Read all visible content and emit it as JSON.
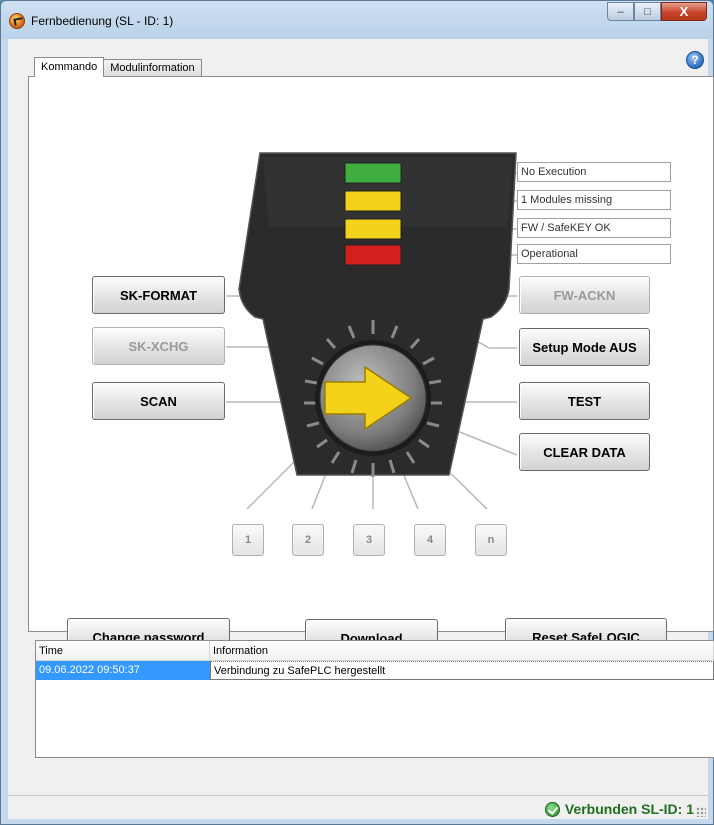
{
  "window": {
    "title": "Fernbedienung (SL - ID: 1)",
    "controls": {
      "minimize": "–",
      "maximize": "□",
      "close": "X"
    }
  },
  "tabs": [
    {
      "label": "Kommando",
      "active": true
    },
    {
      "label": "Modulinformation",
      "active": false
    }
  ],
  "help": {
    "label": "?"
  },
  "status_indicators": [
    {
      "label": "No Execution",
      "led_color": "#3fae3f"
    },
    {
      "label": "1 Modules missing",
      "led_color": "#f2d21a"
    },
    {
      "label": "FW / SafeKEY OK",
      "led_color": "#f2d21a"
    },
    {
      "label": "Operational",
      "led_color": "#d41f1f"
    }
  ],
  "left_buttons": [
    {
      "label": "SK-FORMAT",
      "enabled": true
    },
    {
      "label": "SK-XCHG",
      "enabled": false
    },
    {
      "label": "SCAN",
      "enabled": true
    }
  ],
  "right_buttons": [
    {
      "label": "FW-ACKN",
      "enabled": false
    },
    {
      "label": "Setup Mode AUS",
      "enabled": true
    },
    {
      "label": "TEST",
      "enabled": true
    },
    {
      "label": "CLEAR DATA",
      "enabled": true
    }
  ],
  "number_buttons": [
    "1",
    "2",
    "3",
    "4",
    "n"
  ],
  "action_buttons": {
    "change_password": "Change password",
    "download": "Download",
    "reset": "Reset SafeLOGIC"
  },
  "log": {
    "columns": [
      "Time",
      "Information"
    ],
    "rows": [
      {
        "time": "09.06.2022 09:50:37",
        "info": "Verbindung zu SafePLC hergestellt"
      }
    ]
  },
  "statusbar": {
    "connection": "Verbunden SL-ID: 1"
  },
  "colors": {
    "device_body": "#2a2a2a",
    "arrow": "#f5d21a",
    "selection": "#3399ff",
    "connected": "#1e6f1e"
  }
}
